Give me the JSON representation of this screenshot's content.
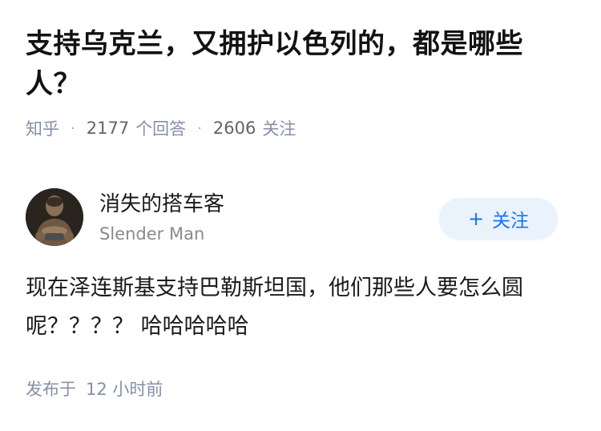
{
  "question": {
    "title": "支持乌克兰，又拥护以色列的，都是哪些人？"
  },
  "meta": {
    "source": "知乎",
    "answer_count": "2177",
    "answer_label": "个回答",
    "follower_count": "2606",
    "follower_label": "关注"
  },
  "author": {
    "name": "消失的搭车客",
    "bio": "Slender Man",
    "avatar_icon": "avatar-photo",
    "follow_label": "关注",
    "follow_icon": "plus-icon"
  },
  "answer": {
    "content": "现在泽连斯基支持巴勒斯坦国，他们那些人要怎么圆呢？？？？ 哈哈哈哈哈"
  },
  "footer": {
    "published_label": "发布于",
    "published_time": "12 小时前"
  },
  "colors": {
    "accent": "#1772f6",
    "follow_bg": "#eaf2fc",
    "meta_text": "#8590a6"
  }
}
